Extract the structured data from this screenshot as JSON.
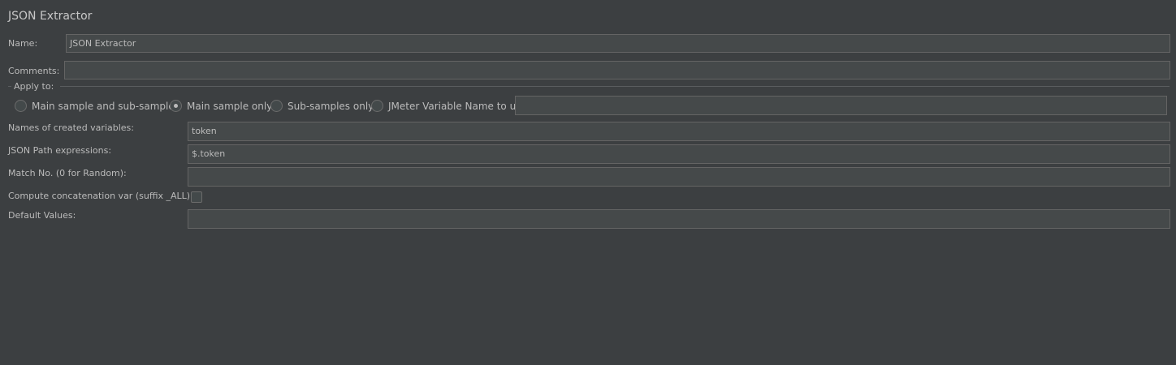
{
  "panel": {
    "title": "JSON Extractor"
  },
  "name": {
    "label": "Name:",
    "value": "JSON Extractor"
  },
  "comments": {
    "label": "Comments:",
    "value": ""
  },
  "apply_to": {
    "label": "Apply to:",
    "options": [
      {
        "label": "Main sample and sub-samples",
        "selected": false
      },
      {
        "label": "Main sample only",
        "selected": true
      },
      {
        "label": "Sub-samples only",
        "selected": false
      },
      {
        "label": "JMeter Variable Name to use",
        "selected": false
      }
    ],
    "variable_name_value": ""
  },
  "variables": {
    "label": "Names of created variables:",
    "value": "token"
  },
  "json_path": {
    "label": "JSON Path expressions:",
    "value": "$.token"
  },
  "match_no": {
    "label": "Match No. (0 for Random):",
    "value": ""
  },
  "concat": {
    "label": "Compute concatenation var (suffix _ALL):",
    "checked": false
  },
  "default_values": {
    "label": "Default Values:",
    "value": ""
  },
  "colors": {
    "background": "#3c3f41",
    "field_background": "#45494a",
    "field_border": "#646464",
    "text": "#bbbbbb"
  }
}
